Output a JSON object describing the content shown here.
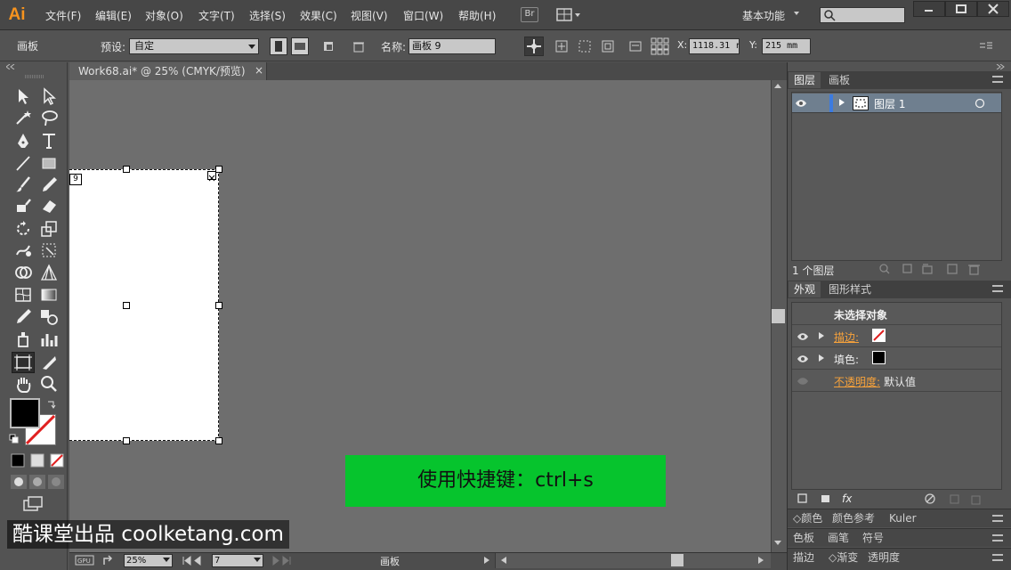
{
  "app": {
    "logo": "Ai",
    "menus": [
      "文件(F)",
      "编辑(E)",
      "对象(O)",
      "文字(T)",
      "选择(S)",
      "效果(C)",
      "视图(V)",
      "窗口(W)",
      "帮助(H)"
    ],
    "bridge_label": "Br",
    "workspace": "基本功能"
  },
  "control_bar": {
    "tool_name": "画板",
    "preset_label": "预设:",
    "preset_value": "自定",
    "name_label": "名称:",
    "name_value": "画板 9",
    "x_label": "X:",
    "x_value": "1118.31 r",
    "y_label": "Y:",
    "y_value": "215 mm"
  },
  "document": {
    "tab_title": "Work68.ai* @ 25% (CMYK/预览)",
    "close_glyph": "×",
    "artboard_tag": "9"
  },
  "banner": {
    "text": "使用快捷键：ctrl+s",
    "color": "#06c42d"
  },
  "watermark": {
    "text": "酷课堂出品 coolketang.com"
  },
  "status_bar": {
    "zoom": "25%",
    "artboard_number": "7",
    "status_label": "画板"
  },
  "layers_panel": {
    "tabs": [
      "图层",
      "画板"
    ],
    "layer_name": "图层 1",
    "footer": "1 个图层"
  },
  "appearance_panel": {
    "tabs": [
      "外观",
      "图形样式"
    ],
    "title": "未选择对象",
    "stroke_label": "描边:",
    "fill_label": "填色:",
    "opacity_label": "不透明度:",
    "opacity_value": "默认值",
    "fx_label": "fx"
  },
  "bottom_panels": {
    "row1": [
      "颜色",
      "颜色参考",
      "Kuler"
    ],
    "row2": [
      "色板",
      "画笔",
      "符号"
    ],
    "row3": [
      "描边",
      "渐变",
      "透明度"
    ]
  },
  "colors": {
    "accent_orange": "#f7931e",
    "selected_layer": "#3c7be0"
  }
}
